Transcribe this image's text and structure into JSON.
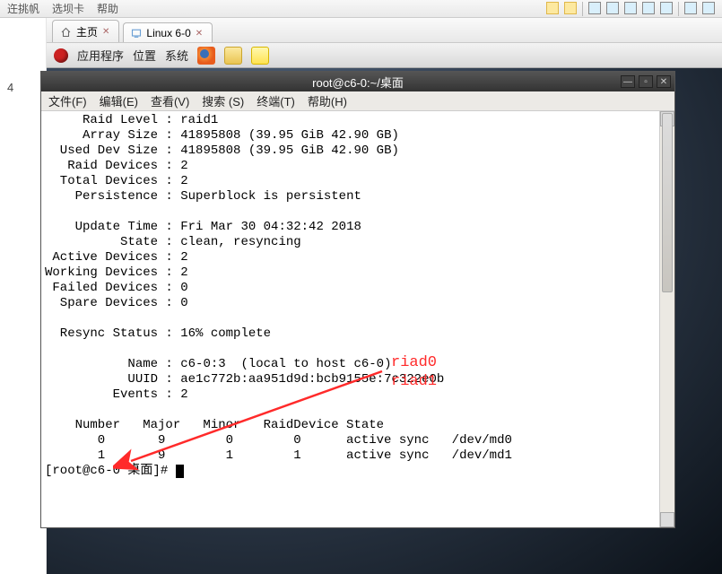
{
  "host_toolbar": {
    "items": [
      "迕挑帆",
      "选坝卡",
      "帮助"
    ],
    "play_icon": "play",
    "pause_icon": "pause"
  },
  "left_sidebar": {
    "number": "4"
  },
  "tabs": [
    {
      "icon": "home",
      "label": "主页"
    },
    {
      "icon": "vm",
      "label": "Linux 6-0"
    }
  ],
  "gnome_panel": {
    "apps_label": "应用程序",
    "places_label": "位置",
    "system_label": "系统"
  },
  "terminal": {
    "title": "root@c6-0:~/桌面",
    "menu": {
      "file": "文件(F)",
      "edit": "编辑(E)",
      "view": "查看(V)",
      "search": "搜索 (S)",
      "terminal": "终端(T)",
      "help": "帮助(H)"
    },
    "mdadm": {
      "raid_level": "raid1",
      "array_size": "41895808 (39.95 GiB 42.90 GB)",
      "used_dev_size": "41895808 (39.95 GiB 42.90 GB)",
      "raid_devices": "2",
      "total_devices": "2",
      "persistence": "Superblock is persistent",
      "update_time": "Fri Mar 30 04:32:42 2018",
      "state": "clean, resyncing",
      "active_devices": "2",
      "working_devices": "2",
      "failed_devices": "0",
      "spare_devices": "0",
      "resync_status": "16% complete",
      "name": "c6-0:3  (local to host c6-0)",
      "uuid": "ae1c772b:aa951d9d:bcb9155e:7c322e0b",
      "events": "2",
      "table_header": "    Number   Major   Minor   RaidDevice State",
      "rows": [
        "       0       9        0        0      active sync   /dev/md0",
        "       1       9        1        1      active sync   /dev/md1"
      ]
    },
    "prompt": "[root@c6-0 桌面]# "
  },
  "annotations": {
    "label0": "riad0",
    "label1": "riad1"
  }
}
